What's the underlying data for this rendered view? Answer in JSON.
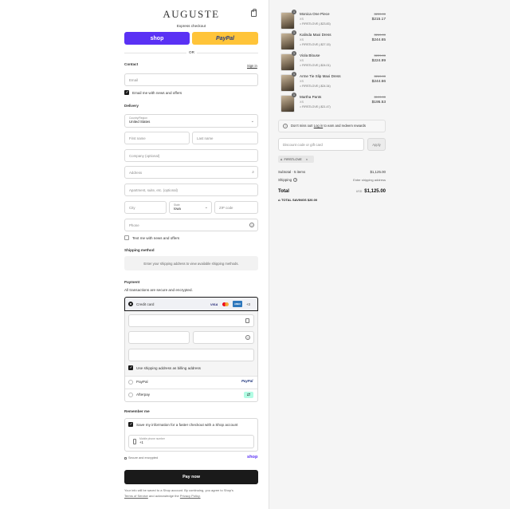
{
  "brand": "AUGUSTE",
  "express": {
    "label": "Express checkout",
    "shop_label": "shop",
    "paypal_label": "PayPal",
    "or": "OR"
  },
  "contact": {
    "title": "Contact",
    "sign_in": "Sign in",
    "email_placeholder": "Email",
    "news_label": "Email me with news and offers"
  },
  "delivery": {
    "title": "Delivery",
    "country_label": "Country/Region",
    "country_value": "United States",
    "first_name": "First name",
    "last_name": "Last name",
    "company": "Company (optional)",
    "address": "Address",
    "apartment": "Apartment, suite, etc. (optional)",
    "city": "City",
    "state_label": "State",
    "state_value": "Iowa",
    "zip": "ZIP code",
    "phone": "Phone",
    "text_label": "Text me with news and offers"
  },
  "shipping": {
    "title": "Shipping method",
    "note": "Enter your shipping address to view available shipping methods."
  },
  "payment": {
    "title": "Payment",
    "subtitle": "All transactions are secure and encrypted.",
    "credit_card": "Credit card",
    "visa": "VISA",
    "amex": "AMEX",
    "more": "+3",
    "billing_label": "Use shipping address as billing address",
    "paypal": "PayPal",
    "afterpay": "Afterpay"
  },
  "remember": {
    "title": "Remember me",
    "save_label": "Save my information for a faster checkout with a Shop account",
    "mobile_label": "Mobile phone number",
    "mobile_value": "+1",
    "secure": "Secure and encrypted",
    "shop": "shop"
  },
  "pay_button": "Pay now",
  "footer": {
    "text_1": "Your info will be saved to a Shop account. By continuing, you agree to Shop's",
    "terms": "Terms of Service",
    "text_2": "and acknowledge the",
    "privacy": "Privacy Policy."
  },
  "products": [
    {
      "qty": "1",
      "name": "Monica One Piece",
      "variant": "XS",
      "discount": "FIRSTLOVE (-$23.83)",
      "old": "$239.00",
      "new": "$215.17"
    },
    {
      "qty": "1",
      "name": "Kalinda Maxi Dress",
      "variant": "XS",
      "discount": "FIRSTLOVE (-$27.15)",
      "old": "$269.00",
      "new": "$244.65"
    },
    {
      "qty": "1",
      "name": "Viola Blouse",
      "variant": "XS",
      "discount": "FIRSTLOVE (-$24.01)",
      "old": "$229.00",
      "new": "$224.99"
    },
    {
      "qty": "1",
      "name": "Arme Tie Slip Maxi Dress",
      "variant": "XS",
      "discount": "FIRSTLOVE (-$24.34)",
      "old": "$269.00",
      "new": "$244.66"
    },
    {
      "qty": "1",
      "name": "Martha Pants",
      "variant": "XS",
      "discount": "FIRSTLOVE (-$21.47)",
      "old": "$199.00",
      "new": "$195.53"
    }
  ],
  "rewards": {
    "text_1": "Don't miss out!",
    "link": "Log in",
    "text_2": "to earn and redeem rewards"
  },
  "discount": {
    "placeholder": "Discount code or gift card",
    "apply": "Apply",
    "tag": "FIRSTLOVE"
  },
  "summary": {
    "subtotal_label": "Subtotal · 5 items",
    "subtotal_value": "$1,125.00",
    "shipping_label": "Shipping",
    "shipping_value": "Enter shipping address",
    "total_label": "Total",
    "currency": "USD",
    "total_value": "$1,125.00",
    "savings_label": "TOTAL SAVINGS",
    "savings_value": "$20.00"
  },
  "colors": {
    "shop_purple": "#5a31f4",
    "paypal_yellow": "#ffc439",
    "pay_button": "#1a1a1a"
  }
}
